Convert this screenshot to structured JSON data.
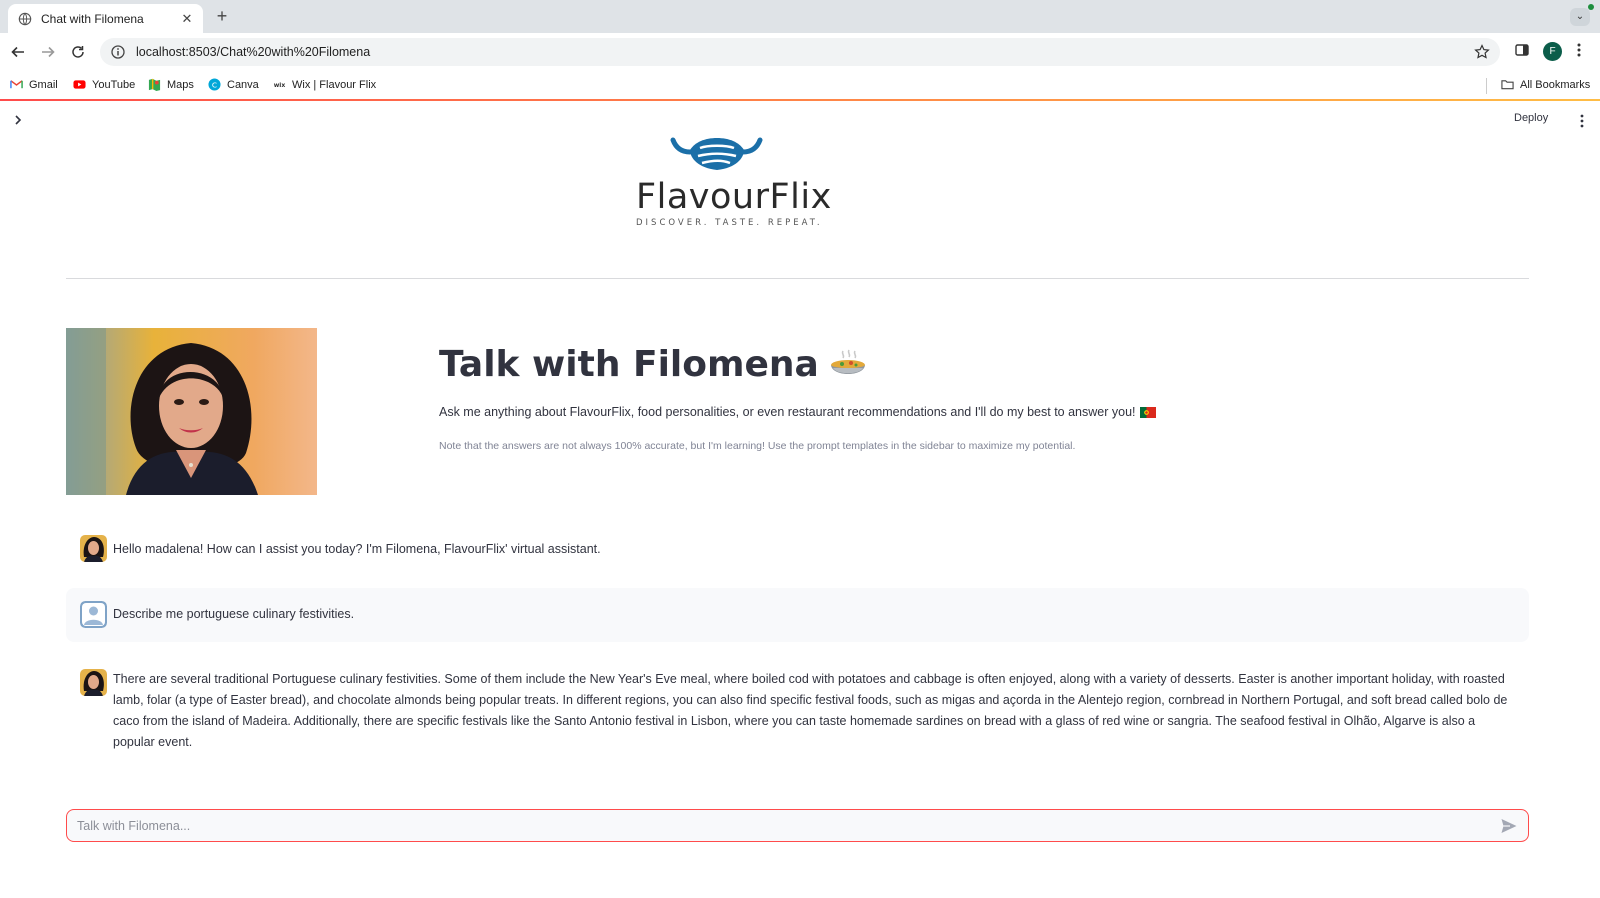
{
  "browser": {
    "tab_title": "Chat with Filomena",
    "url": "localhost:8503/Chat%20with%20Filomena",
    "profile_initial": "F",
    "bookmarks": [
      {
        "label": "Gmail",
        "icon": "gmail-icon"
      },
      {
        "label": "YouTube",
        "icon": "youtube-icon"
      },
      {
        "label": "Maps",
        "icon": "maps-icon"
      },
      {
        "label": "Canva",
        "icon": "canva-icon"
      },
      {
        "label": "Wix | Flavour Flix",
        "icon": "wix-icon"
      }
    ],
    "all_bookmarks": "All Bookmarks"
  },
  "app": {
    "deploy_label": "Deploy",
    "logo_word": "FlavourFlix",
    "logo_tagline": "DISCOVER. TASTE. REPEAT.",
    "title": "Talk with Filomena",
    "subtitle": "Ask me anything about FlavourFlix, food personalities, or even restaurant recommendations and I'll do my best to answer you!",
    "note": "Note that the answers are not always 100% accurate, but I'm learning! Use the prompt templates in the sidebar to maximize my potential."
  },
  "chat": {
    "messages": [
      {
        "role": "assistant",
        "text": "Hello madalena! How can I assist you today? I'm Filomena, FlavourFlix' virtual assistant."
      },
      {
        "role": "user",
        "text": "Describe me portuguese culinary festivities."
      },
      {
        "role": "assistant",
        "text": "There are several traditional Portuguese culinary festivities. Some of them include the New Year's Eve meal, where boiled cod with potatoes and cabbage is often enjoyed, along with a variety of desserts. Easter is another important holiday, with roasted lamb, folar (a type of Easter bread), and chocolate almonds being popular treats. In different regions, you can also find specific festival foods, such as migas and açorda in the Alentejo region, cornbread in Northern Portugal, and soft bread called bolo de caco from the island of Madeira. Additionally, there are specific festivals like the Santo Antonio festival in Lisbon, where you can taste homemade sardines on bread with a glass of red wine or sangria. The seafood festival in Olhão, Algarve is also a popular event."
      }
    ],
    "input_placeholder": "Talk with Filomena..."
  },
  "colors": {
    "accent": "#ff4b4b",
    "logo_blue": "#1b6fa8",
    "text": "#31333f"
  }
}
